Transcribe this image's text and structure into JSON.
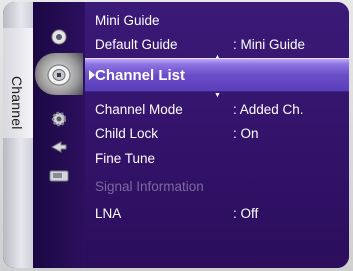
{
  "sidebar": {
    "tab_label": "Channel",
    "icons": [
      {
        "name": "picture-icon"
      },
      {
        "name": "channel-dish-icon"
      },
      {
        "name": "setup-gear-icon"
      },
      {
        "name": "input-icon"
      },
      {
        "name": "application-icon"
      }
    ]
  },
  "menu": {
    "rows": [
      {
        "label": "Mini Guide",
        "value": ""
      },
      {
        "label": "Default Guide",
        "value": ": Mini Guide"
      },
      {
        "label": "Channel List",
        "value": "",
        "selected": true
      },
      {
        "label": "Channel Mode",
        "value": ": Added Ch."
      },
      {
        "label": "Child Lock",
        "value": ": On"
      },
      {
        "label": "Fine Tune",
        "value": ""
      },
      {
        "label": "Signal Information",
        "value": "",
        "disabled": true
      },
      {
        "label": "LNA",
        "value": ": Off"
      }
    ]
  },
  "colors": {
    "panel": "#2b0d5c",
    "highlight": "#6a4ec7",
    "disabled_text": "#7a6aa0"
  }
}
